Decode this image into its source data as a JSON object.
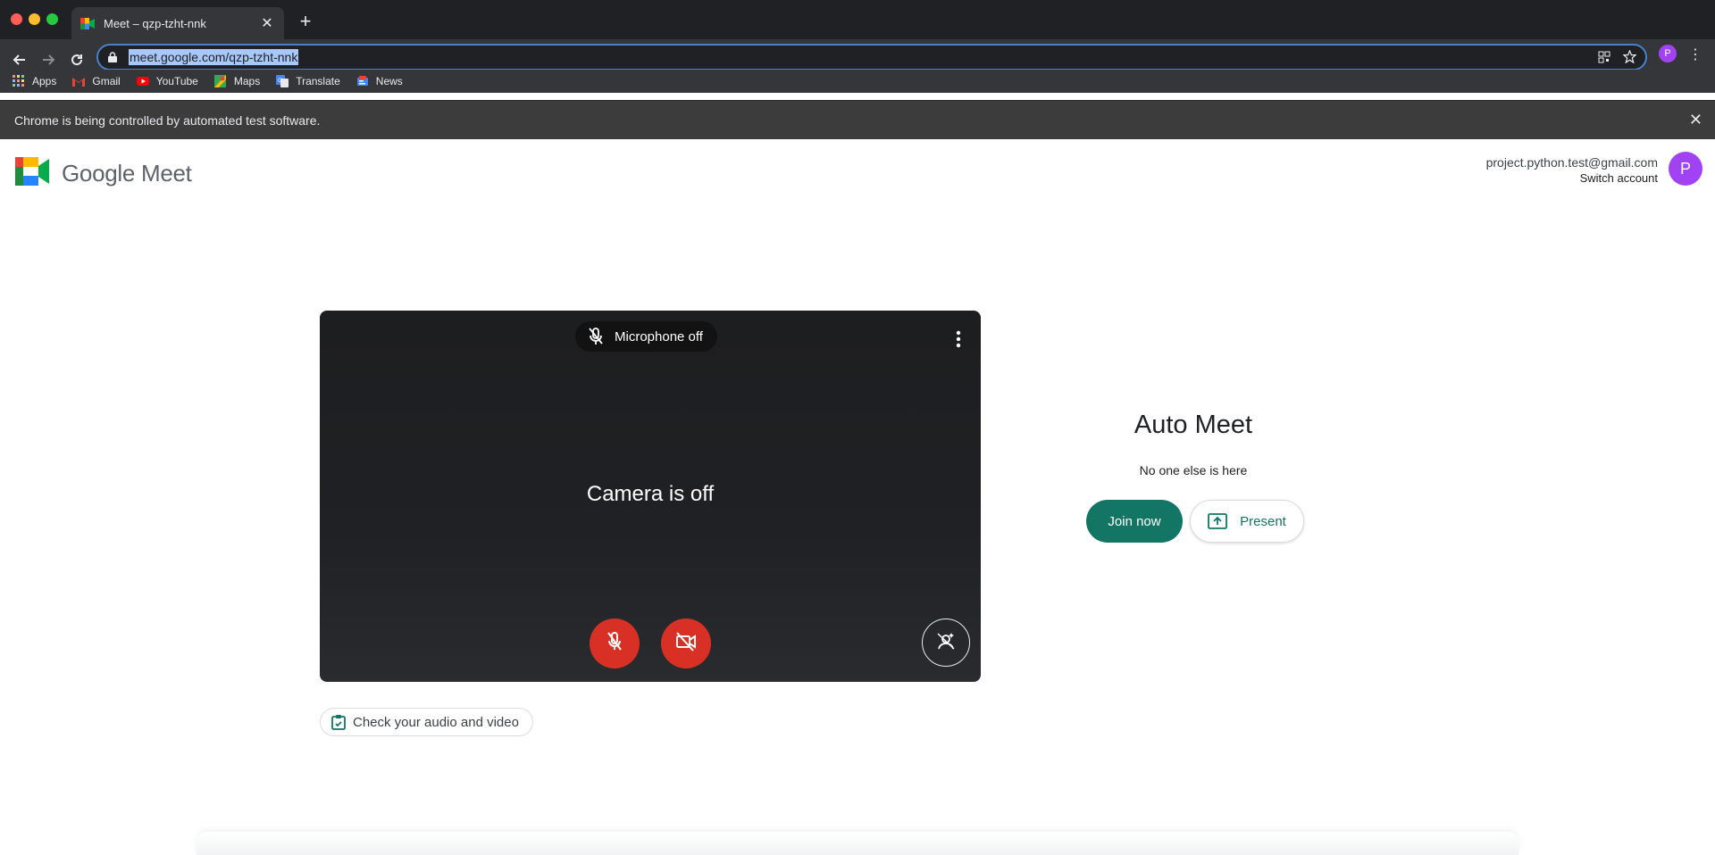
{
  "browser": {
    "tab_title": "Meet – qzp-tzht-nnk",
    "url": "meet.google.com/qzp-tzht-nnk",
    "profile_initial": "P",
    "bookmarks": [
      "Apps",
      "Gmail",
      "YouTube",
      "Maps",
      "Translate",
      "News"
    ],
    "infobar_text": "Chrome is being controlled by automated test software."
  },
  "header": {
    "logo_google": "Google",
    "logo_meet": "Meet",
    "account_email": "project.python.test@gmail.com",
    "switch_account": "Switch account",
    "avatar_initial": "P"
  },
  "preview": {
    "mic_status": "Microphone off",
    "camera_status": "Camera is off",
    "check_av_label": "Check your audio and video"
  },
  "join": {
    "meeting_name": "Auto Meet",
    "participants_status": "No one else is here",
    "join_label": "Join now",
    "present_label": "Present"
  },
  "colors": {
    "accent": "#137564",
    "danger": "#d93025",
    "avatar": "#a142f4"
  }
}
